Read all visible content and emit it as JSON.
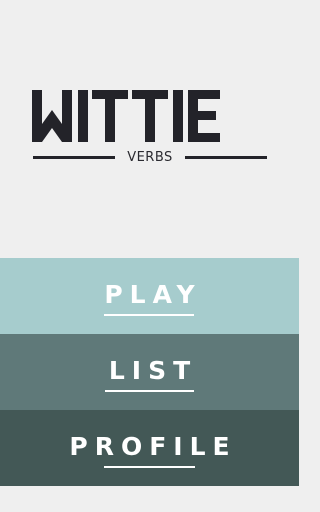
{
  "app": {
    "logo_text": "WITTIE",
    "subtitle": "VERBS"
  },
  "menu": {
    "play_label": "PLAY",
    "list_label": "LIST",
    "profile_label": "PROFILE"
  },
  "colors": {
    "background": "#efefef",
    "logo": "#232329",
    "play": "#a6cccd",
    "list": "#5f7979",
    "profile": "#435856",
    "button_text": "#ffffff"
  }
}
